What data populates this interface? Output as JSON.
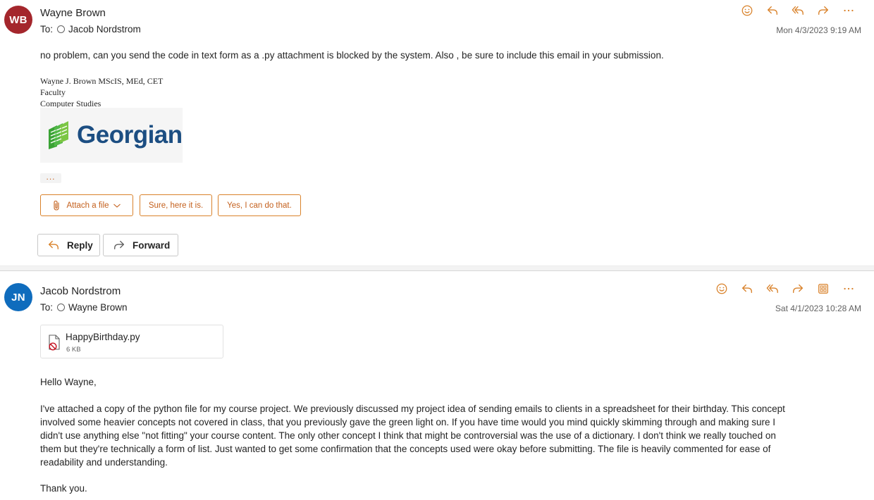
{
  "colors": {
    "accent": "#d9822b",
    "wb_avatar": "#a4262c",
    "jn_avatar": "#0f6cbd"
  },
  "message1": {
    "avatar_initials": "WB",
    "sender": "Wayne Brown",
    "to_label": "To:",
    "to_name": "Jacob Nordstrom",
    "date": "Mon 4/3/2023 9:19 AM",
    "body": "no problem, can you send the code in text form as a .py attachment is blocked by the system.  Also , be sure to include this email in your submission.",
    "signature": [
      "Wayne J. Brown  MScIS, MEd, CET",
      "Faculty",
      "Computer Studies"
    ],
    "logo_text": "Georgian",
    "ellipsis": "...",
    "suggested_replies": {
      "attach": "Attach a file",
      "reply1": "Sure, here it is.",
      "reply2": "Yes, I can do that."
    },
    "reply_label": "Reply",
    "forward_label": "Forward"
  },
  "message2": {
    "avatar_initials": "JN",
    "sender": "Jacob Nordstrom",
    "to_label": "To:",
    "to_name": "Wayne Brown",
    "date": "Sat 4/1/2023 10:28 AM",
    "attachment": {
      "name": "HappyBirthday.py",
      "size": "6 KB"
    },
    "greeting": "Hello Wayne,",
    "body_lines": [
      "I've attached a copy of the python file for my course project. We previously discussed my project idea of sending emails to clients in a spreadsheet for their birthday. This concept",
      "involved some heavier concepts not covered in class, that you previously gave the green light on. If you have time would you mind quickly skimming through and making sure I",
      "didn't use anything else \"not fitting\" your course content. The only other concept I think that might be controversial was the use of a dictionary. I don't think we really touched on",
      "them but they're technically a form of list. Just wanted to get some confirmation that the concepts used were okay before submitting.  The file is heavily commented for ease of",
      "readability and understanding."
    ],
    "closing": "Thank you."
  },
  "icons": {
    "message1_actions": [
      "smile-icon",
      "reply-icon",
      "reply-all-icon",
      "forward-icon",
      "more-icon"
    ],
    "message2_actions": [
      "smile-icon",
      "reply-icon",
      "reply-all-icon",
      "forward-icon",
      "apps-icon",
      "more-icon"
    ]
  }
}
